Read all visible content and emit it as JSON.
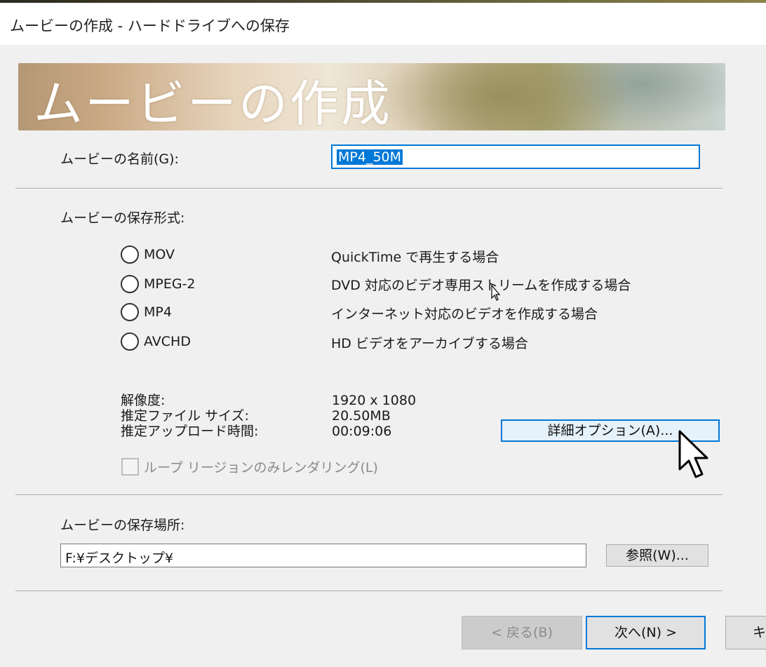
{
  "window": {
    "title": "ムービーの作成 - ハードドライブへの保存"
  },
  "banner": {
    "title": "ムービーの作成"
  },
  "name_field": {
    "label": "ムービーの名前(G):",
    "value": "MP4_50M"
  },
  "format_section": {
    "label": "ムービーの保存形式:",
    "options": [
      {
        "name": "MOV",
        "description": "QuickTime で再生する場合",
        "selected": false
      },
      {
        "name": "MPEG-2",
        "description": "DVD 対応のビデオ専用ストリームを作成する場合",
        "selected": false
      },
      {
        "name": "MP4",
        "description": "インターネット対応のビデオを作成する場合",
        "selected": false
      },
      {
        "name": "AVCHD",
        "description": "HD ビデオをアーカイブする場合",
        "selected": false
      }
    ]
  },
  "info": {
    "resolution_label": "解像度:",
    "resolution_value": "1920 x 1080",
    "filesize_label": "推定ファイル サイズ:",
    "filesize_value": "20.50MB",
    "upload_label": "推定アップロード時間:",
    "upload_value": "00:09:06"
  },
  "detail_button": {
    "label": "詳細オプション(A)..."
  },
  "loop_checkbox": {
    "label": "ループ リージョンのみレンダリング(L)",
    "checked": false,
    "enabled": false
  },
  "location": {
    "label": "ムービーの保存場所:",
    "value": "F:¥デスクトップ¥",
    "browse_label": "参照(W)..."
  },
  "footer": {
    "back_label": "< 戻る(B)",
    "next_label": "次へ(N) >",
    "cancel_label": "キ"
  },
  "colors": {
    "accent": "#0078d7",
    "dialog_bg": "#f0f0f0",
    "disabled_text": "#8b8b8b"
  },
  "icons": {
    "radio": "radio-circle",
    "checkbox": "checkbox-square",
    "cursor_arrow": "mouse-pointer-icon"
  }
}
